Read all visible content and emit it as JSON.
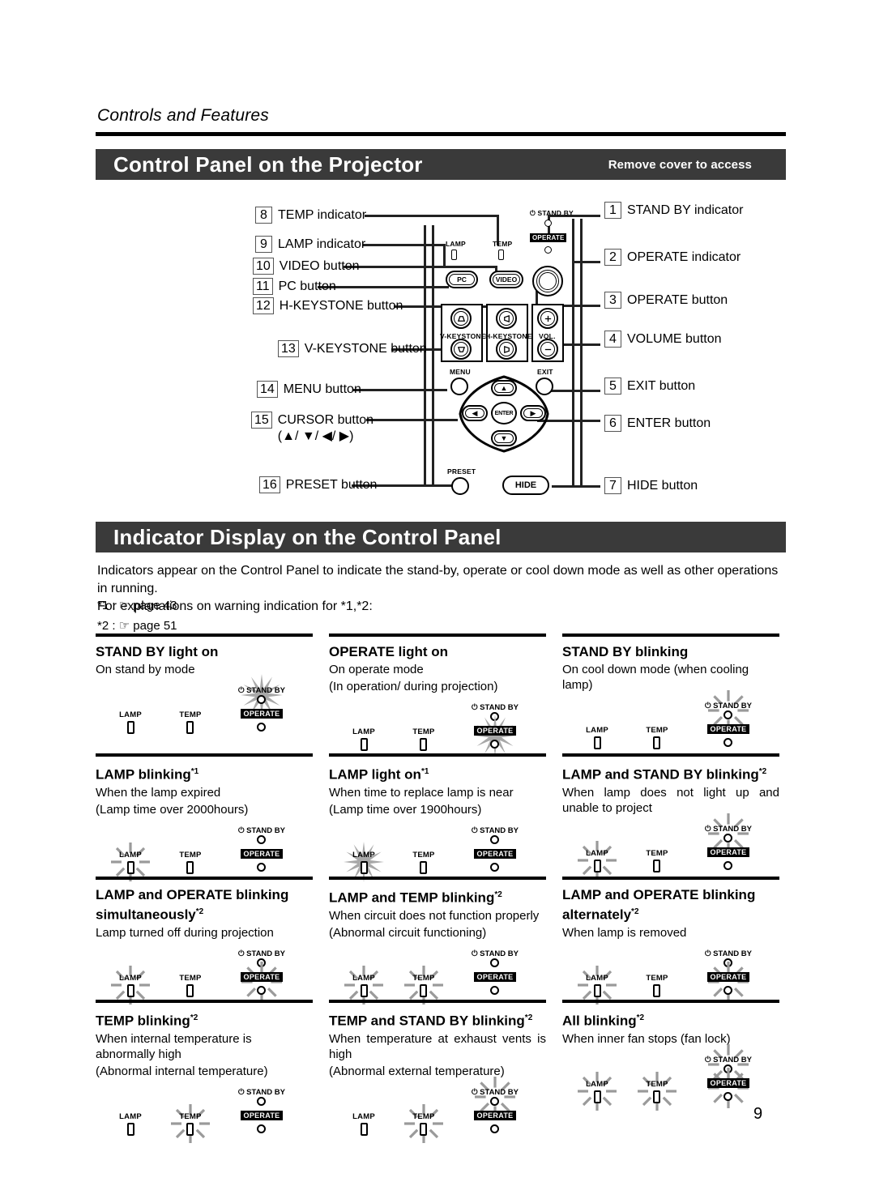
{
  "running_head": "Controls and Features",
  "sections": {
    "control_panel": {
      "title": "Control Panel on the Projector",
      "note": "Remove cover to access"
    },
    "indicator_display": {
      "title": "Indicator Display on the Control Panel"
    }
  },
  "callouts_left": [
    {
      "num": "8",
      "label": "TEMP indicator"
    },
    {
      "num": "9",
      "label": "LAMP indicator"
    },
    {
      "num": "10",
      "label": "VIDEO button"
    },
    {
      "num": "11",
      "label": "PC button"
    },
    {
      "num": "12",
      "label": "H-KEYSTONE button"
    },
    {
      "num": "13",
      "label": "V-KEYSTONE button"
    },
    {
      "num": "14",
      "label": "MENU button"
    },
    {
      "num": "15",
      "label": "CURSOR button",
      "sub": "(▲/ ▼/ ◀/ ▶)"
    },
    {
      "num": "16",
      "label": "PRESET button"
    }
  ],
  "callouts_right": [
    {
      "num": "1",
      "label": "STAND BY indicator"
    },
    {
      "num": "2",
      "label": "OPERATE indicator"
    },
    {
      "num": "3",
      "label": "OPERATE button"
    },
    {
      "num": "4",
      "label": "VOLUME button"
    },
    {
      "num": "5",
      "label": "EXIT button"
    },
    {
      "num": "6",
      "label": "ENTER button"
    },
    {
      "num": "7",
      "label": "HIDE button"
    }
  ],
  "panel_labels": {
    "lamp": "LAMP",
    "temp": "TEMP",
    "stand_by": "STAND BY",
    "operate": "OPERATE",
    "pc": "PC",
    "video": "VIDEO",
    "v_keystone": "V-KEYSTONE",
    "h_keystone": "H-KEYSTONE",
    "vol": "VOL.",
    "menu": "MENU",
    "exit": "EXIT",
    "enter": "ENTER",
    "preset": "PRESET",
    "hide": "HIDE"
  },
  "intro": {
    "line1": "Indicators appear on the Control Panel to indicate the stand-by, operate or cool down mode as well as other operations in running.",
    "line2": "For explanations on warning indication for *1,*2:",
    "ref1": "*1 :  ☞ page 43",
    "ref2": "*2 :  ☞ page 51"
  },
  "indicator_cells": [
    {
      "title": "STAND BY light on",
      "desc": [
        "On stand by mode"
      ],
      "lamp": "off",
      "temp": "off",
      "standby": "on",
      "operate": "off"
    },
    {
      "title": "OPERATE light on",
      "desc": [
        "On operate mode",
        "(In operation/ during projection)"
      ],
      "lamp": "off",
      "temp": "off",
      "standby": "off",
      "operate": "on"
    },
    {
      "title": "STAND BY blinking",
      "desc": [
        "On cool down mode (when cooling lamp)"
      ],
      "lamp": "off",
      "temp": "off",
      "standby": "blink",
      "operate": "off"
    },
    {
      "title": "LAMP blinking*1",
      "desc": [
        "When the lamp expired",
        "(Lamp time over 2000hours)"
      ],
      "lamp": "blink",
      "temp": "off",
      "standby": "off",
      "operate": "off"
    },
    {
      "title": "LAMP light on*1",
      "desc": [
        "When time to replace lamp is near",
        "(Lamp time over 1900hours)"
      ],
      "lamp": "on",
      "temp": "off",
      "standby": "off",
      "operate": "off"
    },
    {
      "title": "LAMP and STAND BY blinking*2",
      "desc": [
        "When lamp does not light up and unable to project"
      ],
      "justify": true,
      "lamp": "blink",
      "temp": "off",
      "standby": "blink",
      "operate": "off"
    },
    {
      "title": "LAMP and OPERATE blinking simultaneously*2",
      "desc": [
        "Lamp turned off during projection"
      ],
      "lamp": "blink",
      "temp": "off",
      "standby": "off",
      "operate": "blink"
    },
    {
      "title": "LAMP and TEMP blinking*2",
      "desc": [
        "When circuit does not function properly",
        "(Abnormal circuit functioning)"
      ],
      "lamp": "blink",
      "temp": "blink",
      "standby": "off",
      "operate": "off"
    },
    {
      "title": "LAMP and OPERATE blinking alternately*2",
      "desc": [
        "When lamp is removed"
      ],
      "lamp": "blink",
      "temp": "off",
      "standby": "off",
      "operate": "blink"
    },
    {
      "title": "TEMP blinking*2",
      "desc": [
        "When internal temperature is abnormally high",
        "(Abnormal internal temperature)"
      ],
      "lamp": "off",
      "temp": "blink",
      "standby": "off",
      "operate": "off"
    },
    {
      "title": "TEMP and STAND BY blinking*2",
      "desc": [
        "When temperature at exhaust vents is high",
        "(Abnormal external temperature)"
      ],
      "justify": true,
      "lamp": "off",
      "temp": "blink",
      "standby": "blink",
      "operate": "off"
    },
    {
      "title": "All blinking*2",
      "desc": [
        "When inner fan stops (fan lock)"
      ],
      "lamp": "blink",
      "temp": "blink",
      "standby": "blink",
      "operate": "blink"
    }
  ],
  "page_number": "9",
  "colors": {
    "bar": "#3a3a3a",
    "rule": "#000000",
    "text": "#000000"
  }
}
